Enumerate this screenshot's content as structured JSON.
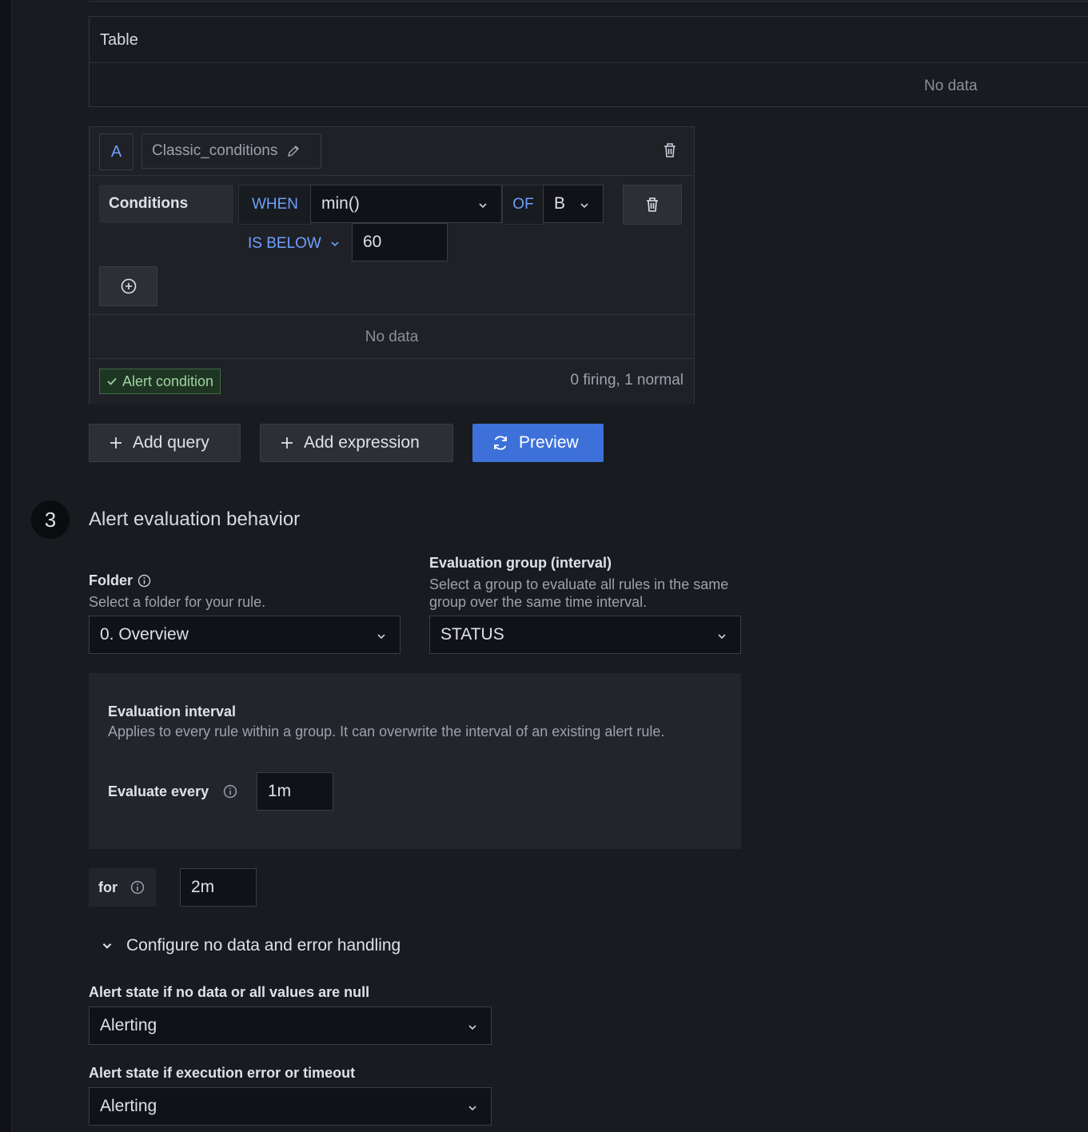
{
  "table_panel": {
    "title": "Table",
    "no_data": "No data"
  },
  "query": {
    "ref_id": "A",
    "name": "Classic_conditions",
    "conditions_label": "Conditions",
    "when": "WHEN",
    "reducer": "min()",
    "of": "OF",
    "query_ref": "B",
    "evaluator": "IS BELOW",
    "threshold": "60",
    "no_data": "No data",
    "alert_condition": "Alert condition",
    "state_summary": "0 firing, 1 normal"
  },
  "actions": {
    "add_query": "Add query",
    "add_expression": "Add expression",
    "preview": "Preview"
  },
  "section3": {
    "number": "3",
    "title": "Alert evaluation behavior",
    "folder_label": "Folder",
    "folder_desc": "Select a folder for your rule.",
    "folder_value": "0. Overview",
    "group_label": "Evaluation group (interval)",
    "group_desc": "Select a group to evaluate all rules in the same group over the same time interval.",
    "group_value": "STATUS",
    "interval_title": "Evaluation interval",
    "interval_desc": "Applies to every rule within a group. It can overwrite the interval of an existing alert rule.",
    "evaluate_every_label": "Evaluate every",
    "evaluate_every_value": "1m",
    "for_label": "for",
    "for_value": "2m",
    "no_data_section": "Configure no data and error handling",
    "no_data_state_label": "Alert state if no data or all values are null",
    "no_data_state_value": "Alerting",
    "error_state_label": "Alert state if execution error or timeout",
    "error_state_value": "Alerting"
  },
  "icons": [
    "trash-icon",
    "pencil-icon",
    "chevron-down-icon",
    "plus-circle-icon",
    "check-icon",
    "plus-icon",
    "refresh-icon",
    "info-icon"
  ]
}
